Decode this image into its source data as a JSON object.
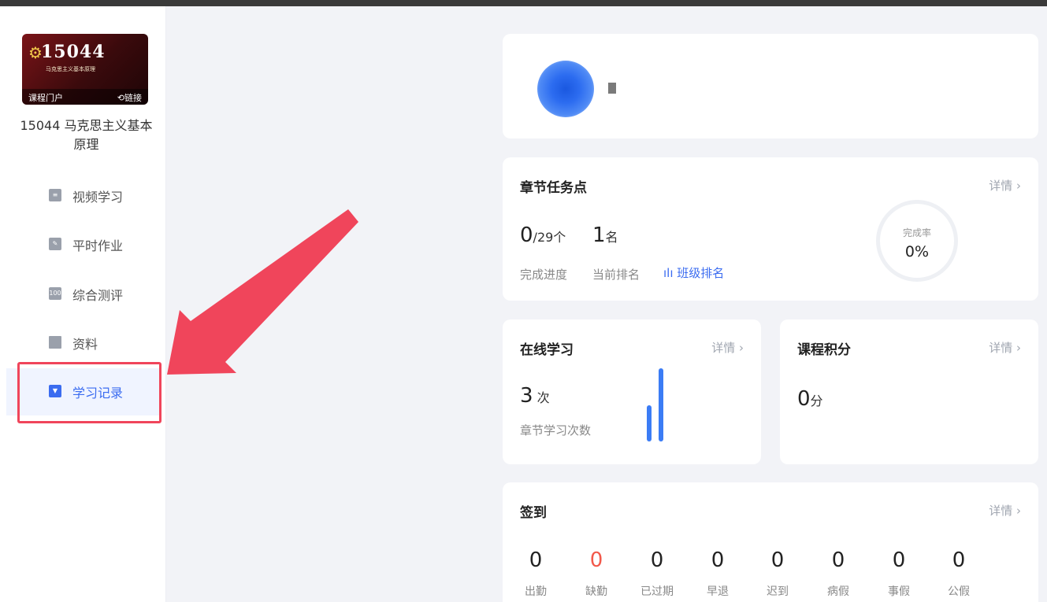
{
  "sidebar": {
    "cover": {
      "number": "15044",
      "subtitle": "马克思主义基本原理",
      "portal_label": "课程门户",
      "link_label": "链接"
    },
    "course_name": "15044 马克思主义基本原理",
    "items": [
      {
        "label": "视频学习",
        "icon": "list-icon"
      },
      {
        "label": "平时作业",
        "icon": "edit-icon"
      },
      {
        "label": "综合测评",
        "icon": "score-icon"
      },
      {
        "label": "资料",
        "icon": "folder-icon"
      },
      {
        "label": "学习记录",
        "icon": "bookmark-icon",
        "active": true
      }
    ]
  },
  "tasks": {
    "title": "章节任务点",
    "detail": "详情 ›",
    "done": "0",
    "total": "/29个",
    "rank": "1",
    "rank_unit": "名",
    "progress_label": "完成进度",
    "rank_label": "当前排名",
    "class_rank_link": "班级排名",
    "completion_label": "完成率",
    "completion_value": "0%"
  },
  "online": {
    "title": "在线学习",
    "detail": "详情 ›",
    "count": "3",
    "unit": "次",
    "label": "章节学习次数"
  },
  "points": {
    "title": "课程积分",
    "detail": "详情 ›",
    "value": "0",
    "unit": "分"
  },
  "signin": {
    "title": "签到",
    "detail": "详情 ›",
    "stats": [
      {
        "value": "0",
        "label": "出勤"
      },
      {
        "value": "0",
        "label": "缺勤",
        "highlight": true
      },
      {
        "value": "0",
        "label": "已过期"
      },
      {
        "value": "0",
        "label": "早退"
      },
      {
        "value": "0",
        "label": "迟到"
      },
      {
        "value": "0",
        "label": "病假"
      },
      {
        "value": "0",
        "label": "事假"
      },
      {
        "value": "0",
        "label": "公假"
      }
    ]
  },
  "colors": {
    "accent": "#3b6cf0",
    "highlight_box": "#f0455b",
    "absent": "#f2594b"
  }
}
